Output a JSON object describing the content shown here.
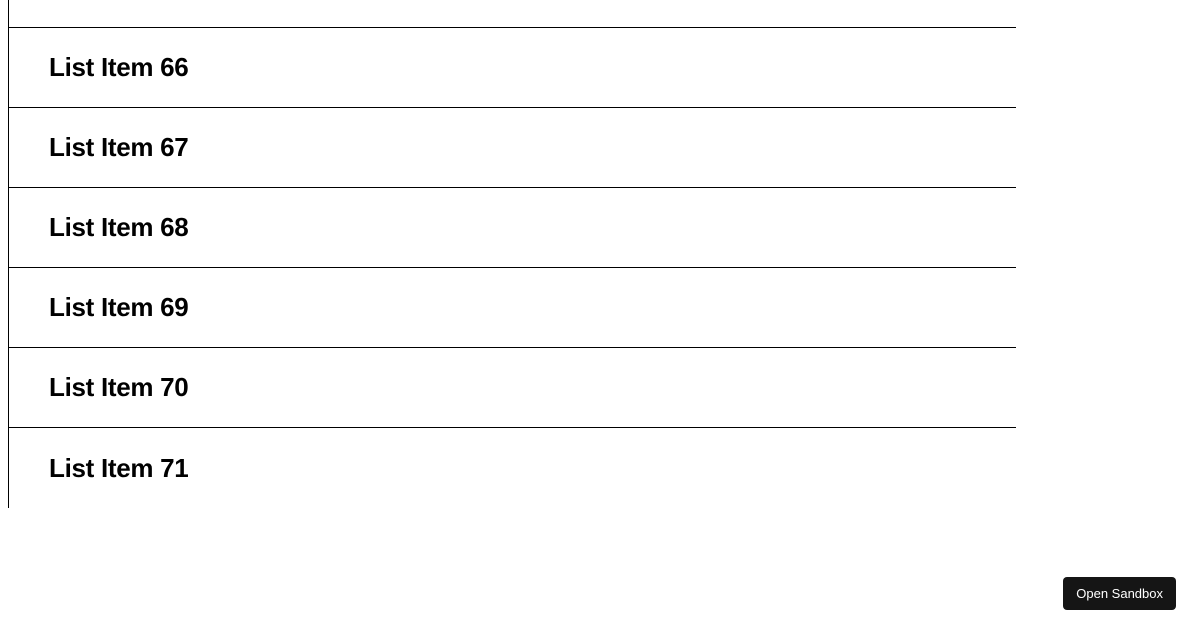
{
  "list": {
    "items": [
      {
        "label": ""
      },
      {
        "label": "List Item 66"
      },
      {
        "label": "List Item 67"
      },
      {
        "label": "List Item 68"
      },
      {
        "label": "List Item 69"
      },
      {
        "label": "List Item 70"
      },
      {
        "label": "List Item 71"
      }
    ]
  },
  "footer": {
    "open_sandbox_label": "Open Sandbox"
  }
}
